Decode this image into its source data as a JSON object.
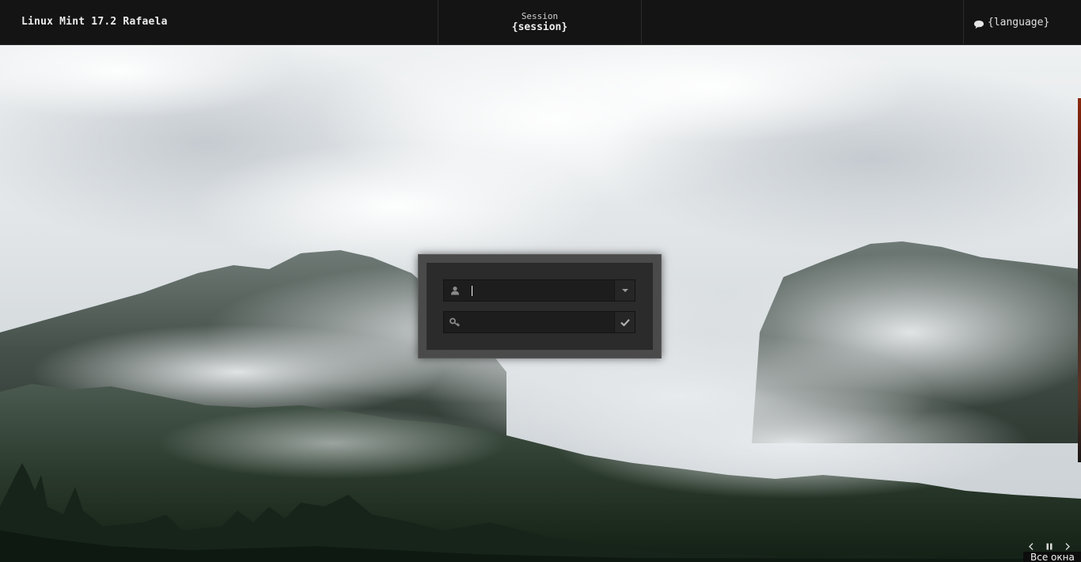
{
  "topbar": {
    "hostname": "Linux Mint 17.2 Rafaela",
    "session_label": "Session",
    "session_value": "{session}",
    "language_value": "{language}",
    "language_icon": "speech-bubble-icon"
  },
  "login": {
    "username_value": "",
    "password_value": "",
    "user_icon": "user-icon",
    "password_icon": "key-icon",
    "dropdown_icon": "chevron-down-icon",
    "submit_icon": "checkmark-icon"
  },
  "workspace": {
    "all_windows_label": "Все окна",
    "prev_icon": "chevron-left-icon",
    "pause_icon": "pause-icon",
    "next_icon": "chevron-right-icon"
  },
  "colors": {
    "panel": "#141414",
    "login_frame": "#4a4a4a",
    "login_inner": "#2b2b2b",
    "field_bg": "#1d1d1d"
  }
}
